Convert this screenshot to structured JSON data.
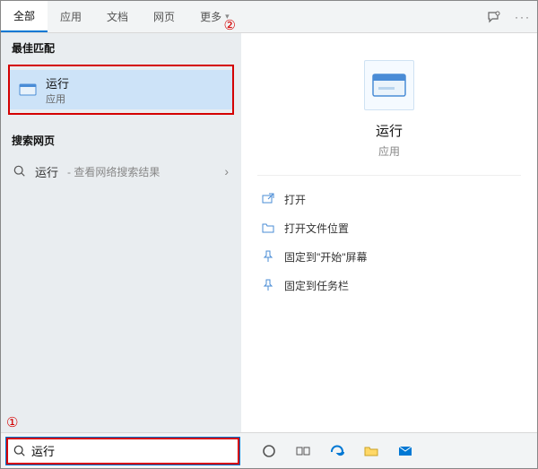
{
  "tabs": {
    "all": "全部",
    "apps": "应用",
    "docs": "文档",
    "web": "网页",
    "more": "更多"
  },
  "annotations": {
    "one": "①",
    "two": "②"
  },
  "left": {
    "bestMatchHeader": "最佳匹配",
    "bestMatch": {
      "title": "运行",
      "subtitle": "应用"
    },
    "searchWebHeader": "搜索网页",
    "webItem": {
      "term": "运行",
      "hint": " - 查看网络搜索结果"
    }
  },
  "detail": {
    "title": "运行",
    "subtitle": "应用",
    "actions": {
      "open": "打开",
      "openLocation": "打开文件位置",
      "pinStart": "固定到\"开始\"屏幕",
      "pinTaskbar": "固定到任务栏"
    }
  },
  "search": {
    "value": "运行"
  }
}
